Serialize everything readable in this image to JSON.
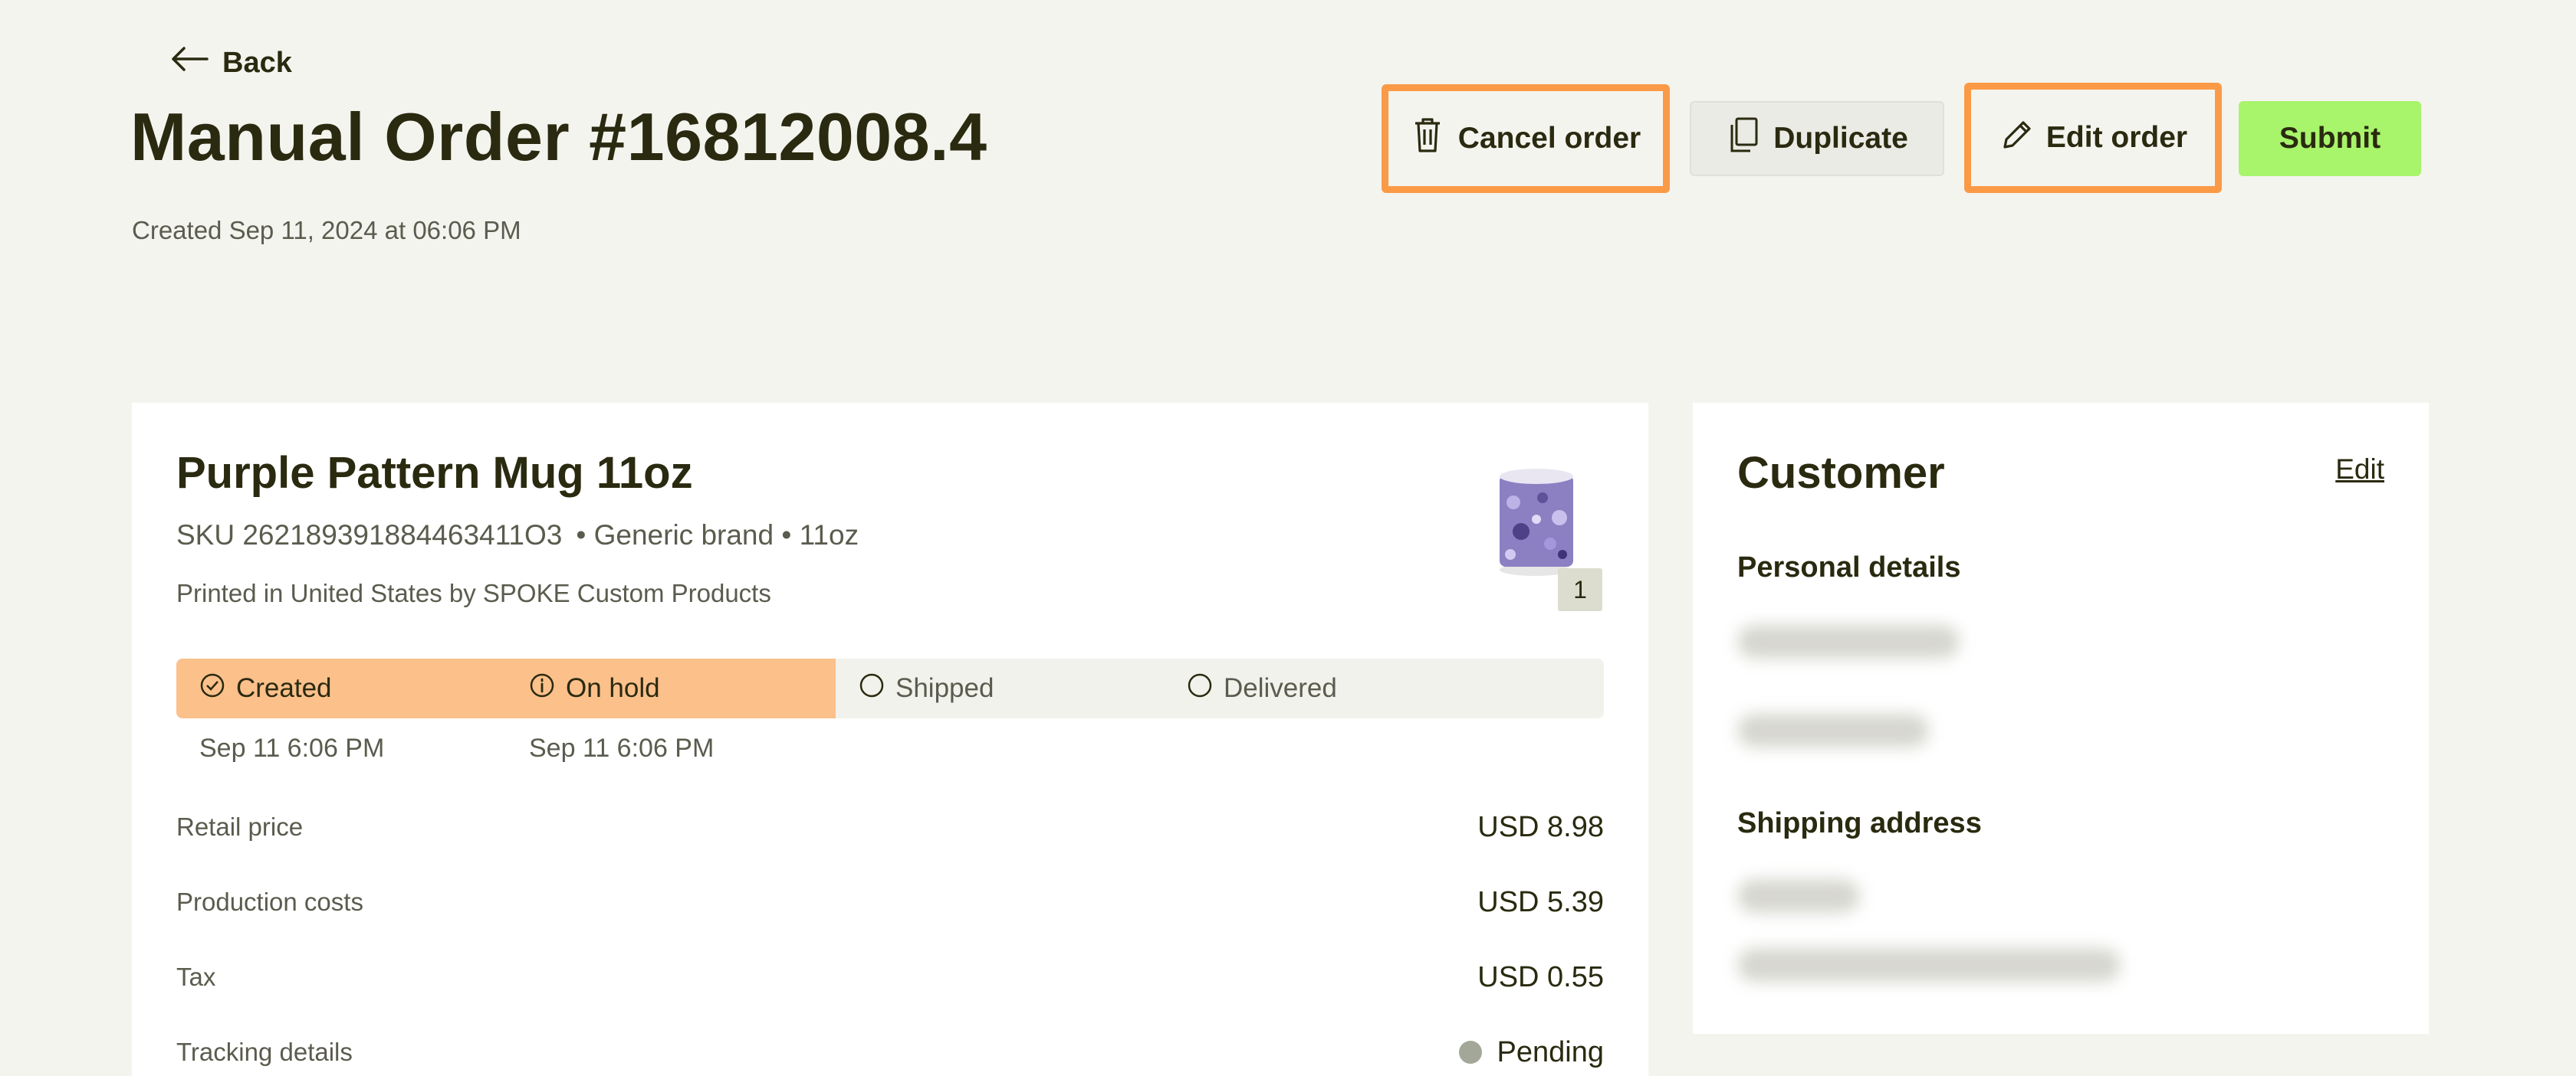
{
  "header": {
    "back_label": "Back",
    "title": "Manual Order #16812008.4",
    "created": "Created Sep 11, 2024 at 06:06 PM"
  },
  "actions": {
    "cancel_label": "Cancel order",
    "duplicate_label": "Duplicate",
    "edit_label": "Edit order",
    "submit_label": "Submit"
  },
  "icons": {
    "back": "arrow-left-icon",
    "cancel": "trash-icon",
    "duplicate": "copy-icon",
    "edit": "pencil-icon"
  },
  "order": {
    "product_name": "Purple Pattern Mug 11oz",
    "sku": "SKU 262189391884463411O3",
    "brand": "• Generic brand • 11oz",
    "printed": "Printed in United States by SPOKE Custom Products",
    "quantity": "1",
    "status_steps": [
      {
        "label": "Created",
        "date": "Sep 11 6:06 PM",
        "state": "done"
      },
      {
        "label": "On hold",
        "date": "Sep 11 6:06 PM",
        "state": "info"
      },
      {
        "label": "Shipped",
        "date": "",
        "state": "pending"
      },
      {
        "label": "Delivered",
        "date": "",
        "state": "pending"
      }
    ],
    "rows": [
      {
        "label": "Retail price",
        "value": "USD 8.98"
      },
      {
        "label": "Production costs",
        "value": "USD 5.39"
      },
      {
        "label": "Tax",
        "value": "USD 0.55"
      },
      {
        "label": "Tracking details",
        "value": "Pending"
      }
    ]
  },
  "customer": {
    "title": "Customer",
    "edit_label": "Edit",
    "personal_heading": "Personal details",
    "shipping_heading": "Shipping address"
  },
  "colors": {
    "background": "#f4f4ef",
    "accent_highlight": "#fb9a46",
    "status_active": "#fcc08b",
    "submit": "#a8f46b",
    "text": "#2a2a10"
  }
}
